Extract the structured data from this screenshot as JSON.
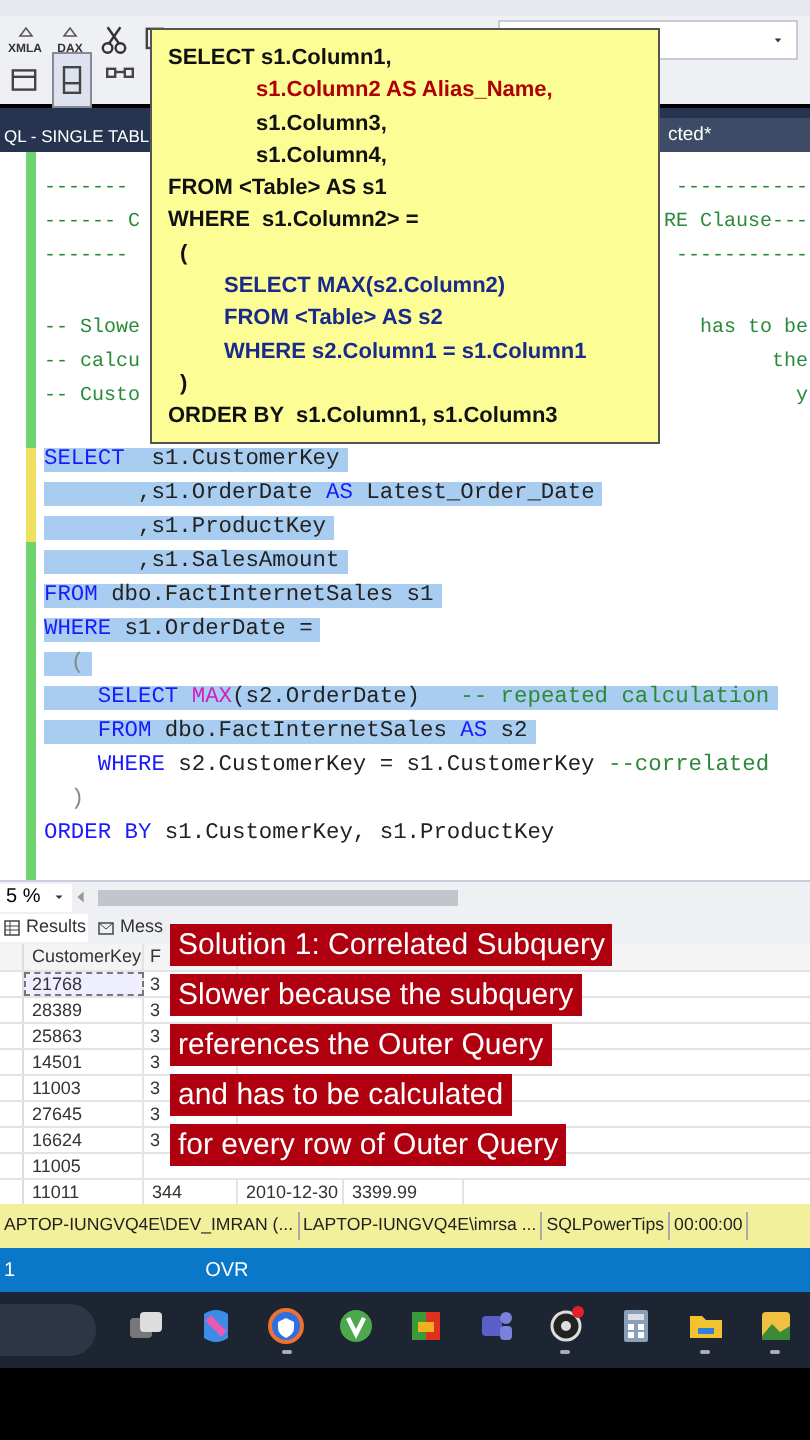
{
  "toolbar": {
    "labels": [
      "XMLA",
      "DAX"
    ],
    "dropdown": {
      "expanded": false
    }
  },
  "tabs": [
    {
      "label": "QL - SINGLE TABL",
      "selected": false
    },
    {
      "label": "cted*",
      "selected": true
    }
  ],
  "editor": {
    "header_comment": [
      {
        "left": "-------",
        "right": "-----------"
      },
      {
        "left": "------ C",
        "right": "RE Clause---"
      },
      {
        "left": "-------",
        "right": "-----------"
      }
    ],
    "note_comment": [
      {
        "left": "-- Slowe",
        "right": "has to be"
      },
      {
        "left": "-- calcu",
        "right": "the"
      },
      {
        "left": "-- Custo",
        "right": "y"
      }
    ],
    "query": [
      {
        "selected": true,
        "tokens": [
          {
            "kind": "kw",
            "text": "SELECT"
          },
          {
            "kind": "tx",
            "text": "  s1.CustomerKey"
          }
        ]
      },
      {
        "selected": true,
        "tokens": [
          {
            "kind": "tx",
            "text": "       ,s1.OrderDate "
          },
          {
            "kind": "kw",
            "text": "AS"
          },
          {
            "kind": "tx",
            "text": " Latest_Order_Date"
          }
        ]
      },
      {
        "selected": true,
        "tokens": [
          {
            "kind": "tx",
            "text": "       ,s1.ProductKey"
          }
        ]
      },
      {
        "selected": true,
        "tokens": [
          {
            "kind": "tx",
            "text": "       ,s1.SalesAmount"
          }
        ]
      },
      {
        "selected": true,
        "tokens": [
          {
            "kind": "kw",
            "text": "FROM"
          },
          {
            "kind": "tx",
            "text": " dbo.FactInternetSales s1"
          }
        ]
      },
      {
        "selected": true,
        "tokens": [
          {
            "kind": "kw",
            "text": "WHERE"
          },
          {
            "kind": "tx",
            "text": " s1.OrderDate ="
          }
        ]
      },
      {
        "selected": true,
        "tokens": [
          {
            "kind": "op",
            "text": "  ("
          }
        ]
      },
      {
        "selected": true,
        "tokens": [
          {
            "kind": "kw",
            "text": "    SELECT "
          },
          {
            "kind": "fn",
            "text": "MAX"
          },
          {
            "kind": "tx",
            "text": "(s2.OrderDate)   "
          },
          {
            "kind": "cm",
            "text": "-- repeated calculation"
          }
        ]
      },
      {
        "selected": true,
        "tokens": [
          {
            "kind": "kw",
            "text": "    FROM"
          },
          {
            "kind": "tx",
            "text": " dbo.FactInternetSales "
          },
          {
            "kind": "kw",
            "text": "AS"
          },
          {
            "kind": "tx",
            "text": " s2"
          }
        ]
      },
      {
        "selected": false,
        "tokens": [
          {
            "kind": "kw",
            "text": "    WHERE"
          },
          {
            "kind": "tx",
            "text": " s2.CustomerKey = s1.CustomerKey "
          },
          {
            "kind": "cm",
            "text": "--correlated"
          }
        ]
      },
      {
        "selected": false,
        "tokens": [
          {
            "kind": "op",
            "text": "  )"
          }
        ]
      },
      {
        "selected": false,
        "tokens": [
          {
            "kind": "kw",
            "text": "ORDER BY"
          },
          {
            "kind": "tx",
            "text": " s1.CustomerKey, s1.ProductKey"
          }
        ]
      }
    ]
  },
  "template_popup": [
    {
      "kind": "main",
      "text": "SELECT s1.Column1,"
    },
    {
      "kind": "alias",
      "text": "s1.Column2 AS Alias_Name,"
    },
    {
      "kind": "column",
      "text": "s1.Column3,"
    },
    {
      "kind": "column",
      "text": "s1.Column4,"
    },
    {
      "kind": "main",
      "text": "FROM <Table> AS s1"
    },
    {
      "kind": "main",
      "text": "WHERE  s1.Column2> ="
    },
    {
      "kind": "paren",
      "text": "("
    },
    {
      "kind": "sub",
      "text": "SELECT MAX(s2.Column2)"
    },
    {
      "kind": "sub",
      "text": "FROM <Table> AS s2"
    },
    {
      "kind": "sub",
      "text": "WHERE s2.Column1 = s1.Column1"
    },
    {
      "kind": "paren",
      "text": ")"
    },
    {
      "kind": "main",
      "text": "ORDER BY  s1.Column1, s1.Column3"
    }
  ],
  "zoom": {
    "value": "5 %"
  },
  "result_tabs": [
    {
      "label": "Results",
      "selected": true
    },
    {
      "label": "Mess",
      "selected": false
    }
  ],
  "grid": {
    "columns": [
      "CustomerKey",
      "F"
    ],
    "rows": [
      {
        "selected": true,
        "cells": [
          "21768",
          "3"
        ]
      },
      {
        "selected": false,
        "cells": [
          "28389",
          "3"
        ]
      },
      {
        "selected": false,
        "cells": [
          "25863",
          "3"
        ]
      },
      {
        "selected": false,
        "cells": [
          "14501",
          "3"
        ]
      },
      {
        "selected": false,
        "cells": [
          "11003",
          "3"
        ]
      },
      {
        "selected": false,
        "cells": [
          "27645",
          "3"
        ]
      },
      {
        "selected": false,
        "cells": [
          "16624",
          "3"
        ]
      },
      {
        "selected": false,
        "cells": [
          "11005"
        ]
      },
      {
        "selected": false,
        "cells": [
          "11011",
          "344",
          "2010-12-30",
          "3399.99"
        ]
      }
    ]
  },
  "captions": [
    "Solution 1: Correlated Subquery",
    "Slower because the subquery",
    "references the Outer Query",
    "and has to be calculated",
    "for every row of Outer Query"
  ],
  "status_bar": [
    "APTOP-IUNGVQ4E\\DEV_IMRAN (...",
    "LAPTOP-IUNGVQ4E\\imrsa ...",
    "SQLPowerTips",
    "00:00:00"
  ],
  "editor_status": [
    "1",
    "OVR"
  ],
  "taskbar": {
    "apps": [
      {
        "kind": "taskview",
        "running": false
      },
      {
        "kind": "copilot",
        "running": false
      },
      {
        "kind": "browser",
        "running": true
      },
      {
        "kind": "vapp",
        "running": false
      },
      {
        "kind": "blocks",
        "running": false
      },
      {
        "kind": "teams",
        "running": false
      },
      {
        "kind": "recorder",
        "running": true
      },
      {
        "kind": "calculator",
        "running": false
      },
      {
        "kind": "folder",
        "running": true
      },
      {
        "kind": "photo",
        "running": true
      }
    ]
  }
}
